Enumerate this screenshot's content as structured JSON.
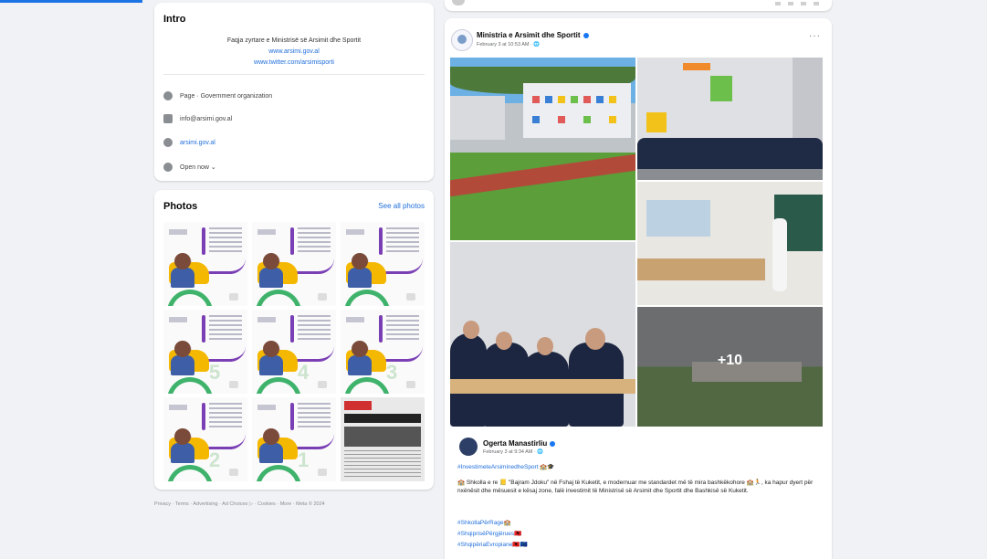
{
  "intro": {
    "title": "Intro",
    "bio_line1": "Faqja zyrtare e Ministrisë së Arsimit dhe Sportit",
    "bio_line2": "www.arsimi.gov.al",
    "bio_line3": "www.twitter.com/arsimisporti",
    "category": "Page · Government organization",
    "email": "info@arsimi.gov.al",
    "website": "arsimi.gov.al",
    "hours": "Open now ⌄"
  },
  "photos": {
    "title": "Photos",
    "see_all": "See all photos",
    "numbers": [
      "",
      "",
      "",
      "5",
      "4",
      "3",
      "2",
      "1",
      ""
    ]
  },
  "footer": "Privacy · Terms · Advertising · Ad Choices ▷ · Cookies · More · Meta © 2024",
  "post": {
    "page_name": "Ministria e Arsimit dhe Sportit",
    "date": "February 3 at 10:53 AM · 🌐",
    "more": "···",
    "more_photos": "+10",
    "shared_name": "Ogerta Manastirliu",
    "shared_date": "February 3 at 9:34 AM · 🌐",
    "hashtag_top": "#InvestimeteArsiminedheSport 🏫🎓",
    "body": "🏫 Shkolla e re 📒 \"Bajram Jdoku\" në Fshaj të Kuketit, e modernuar me standardet më të mira bashkëkohore 🏫🏃, ka hapur dyert për nxënësit dhe mësuesit e kësaj zone, falë investimit të Ministrisë së Arsimit dhe Sportit dhe Bashkisë së Kuketit.",
    "hashtag_1": "#ShkollaPërRage🏫",
    "hashtag_2": "#ShqiprisëPërgjërues🇦🇱",
    "hashtag_3": "#ShqipëriaEvropiane🇦🇱🇪🇺"
  }
}
